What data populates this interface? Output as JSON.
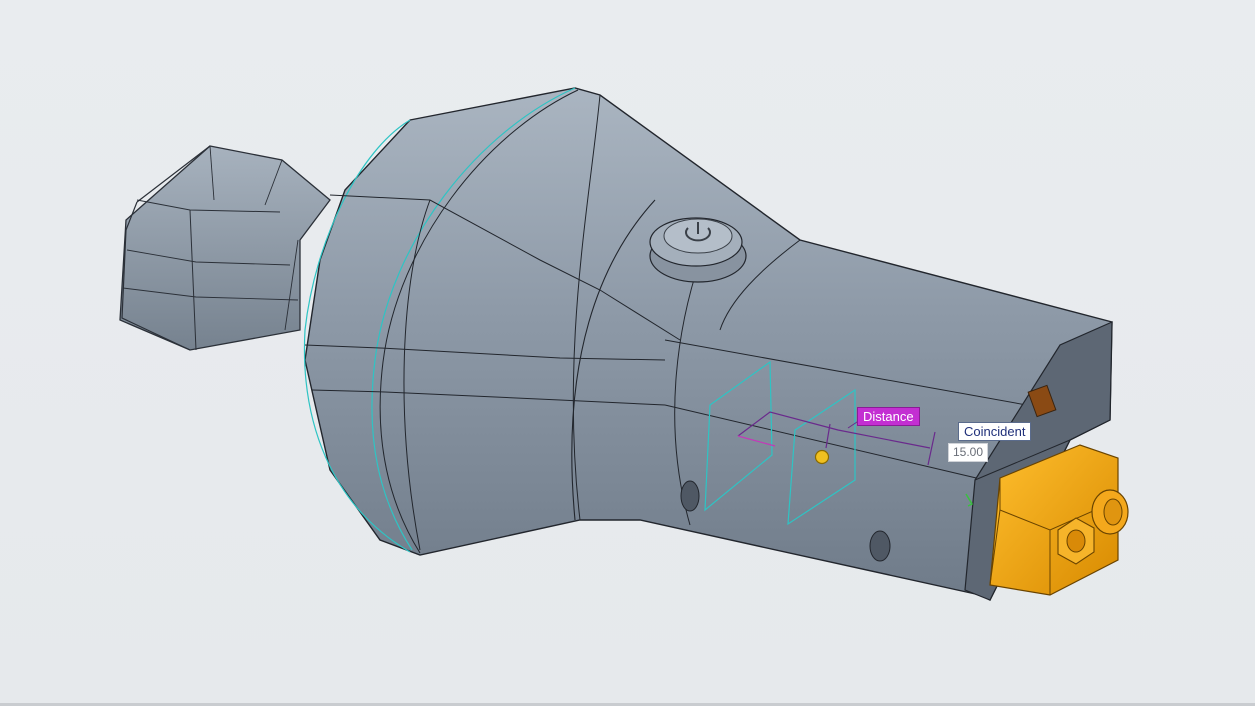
{
  "viewport": {
    "background": "#e8ebee",
    "model_color": "#8e9aa8",
    "selected_part_color": "#f0a000",
    "constraint_color": "#6a2a8c",
    "datum_plane_color": "#2ec4c4"
  },
  "annotations": {
    "distance_label": "Distance",
    "coincident_label": "Coincident",
    "dimension_value": "15.00"
  },
  "icons": {
    "power_button": "power-icon"
  }
}
